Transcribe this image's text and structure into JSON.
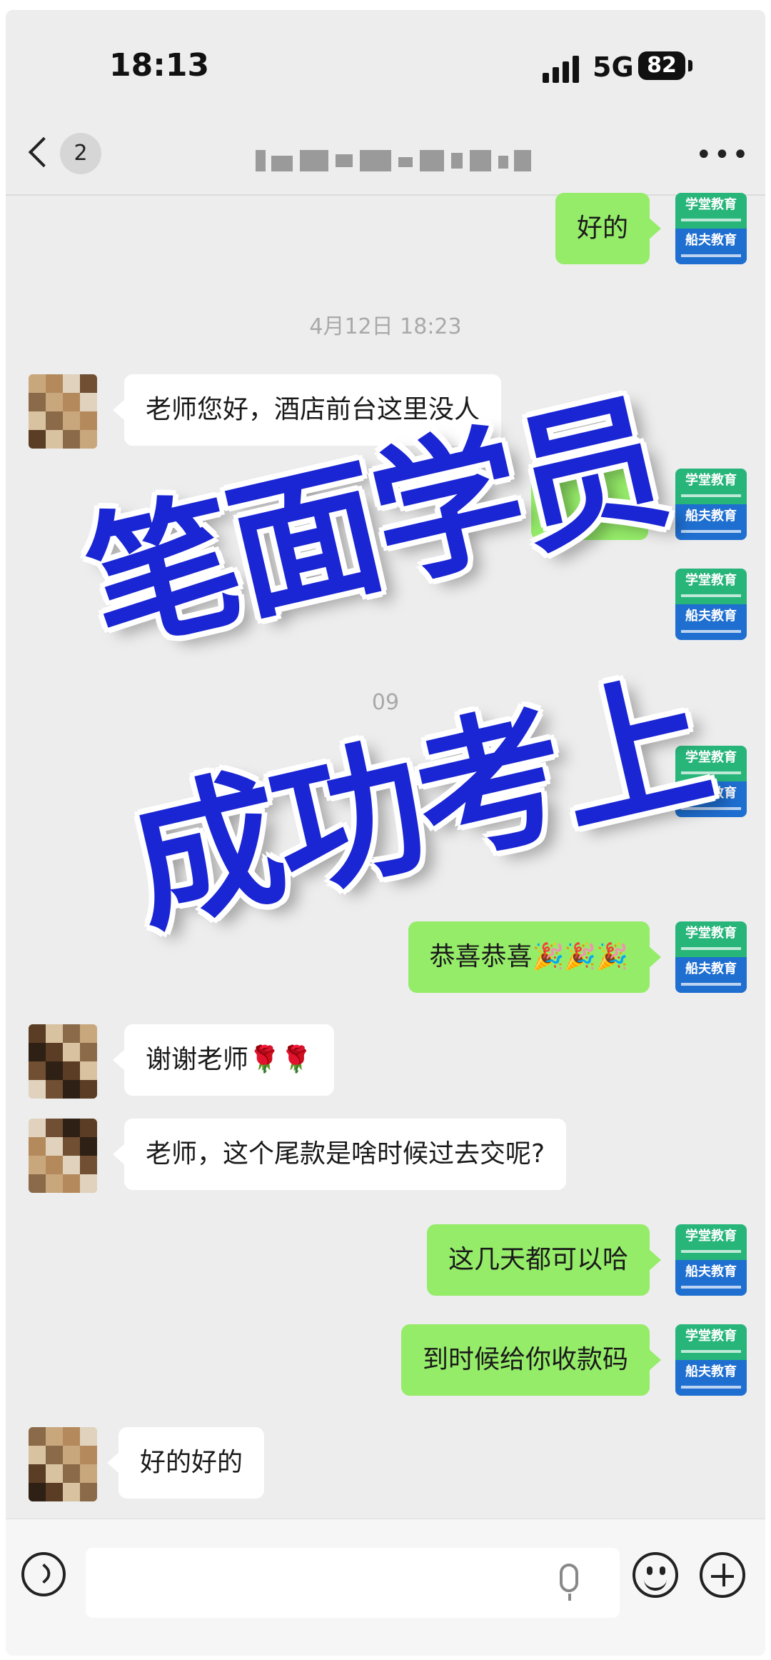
{
  "status_bar": {
    "time": "18:13",
    "network": "5G",
    "battery": "82"
  },
  "header": {
    "unread_count": "2"
  },
  "messages": [
    {
      "side": "self",
      "text": "好的"
    },
    {
      "timestamp": "4月12日 18:23"
    },
    {
      "side": "other",
      "text": "老师您好，酒店前台这里没人"
    },
    {
      "side": "self",
      "text": ""
    },
    {
      "side": "self",
      "text": ""
    },
    {
      "timestamp": "09"
    },
    {
      "side": "self",
      "text": ""
    },
    {
      "side": "self",
      "text": "恭喜恭喜🎉🎉🎉"
    },
    {
      "side": "other",
      "text": "谢谢老师🌹🌹"
    },
    {
      "side": "other",
      "text": "老师，这个尾款是啥时候过去交呢?"
    },
    {
      "side": "self",
      "text": "这几天都可以哈"
    },
    {
      "side": "self",
      "text": "到时候给你收款码"
    },
    {
      "side": "other",
      "text": "好的好的"
    }
  ],
  "avatar_self": {
    "top_text": "学堂教育",
    "bottom_text": "船夫教育"
  },
  "overlay": {
    "line1": "笔面学员",
    "line2": "成功考上"
  },
  "colors": {
    "self_bubble": "#95ec69",
    "overlay_text": "#1a25d4",
    "background": "#ededed"
  }
}
